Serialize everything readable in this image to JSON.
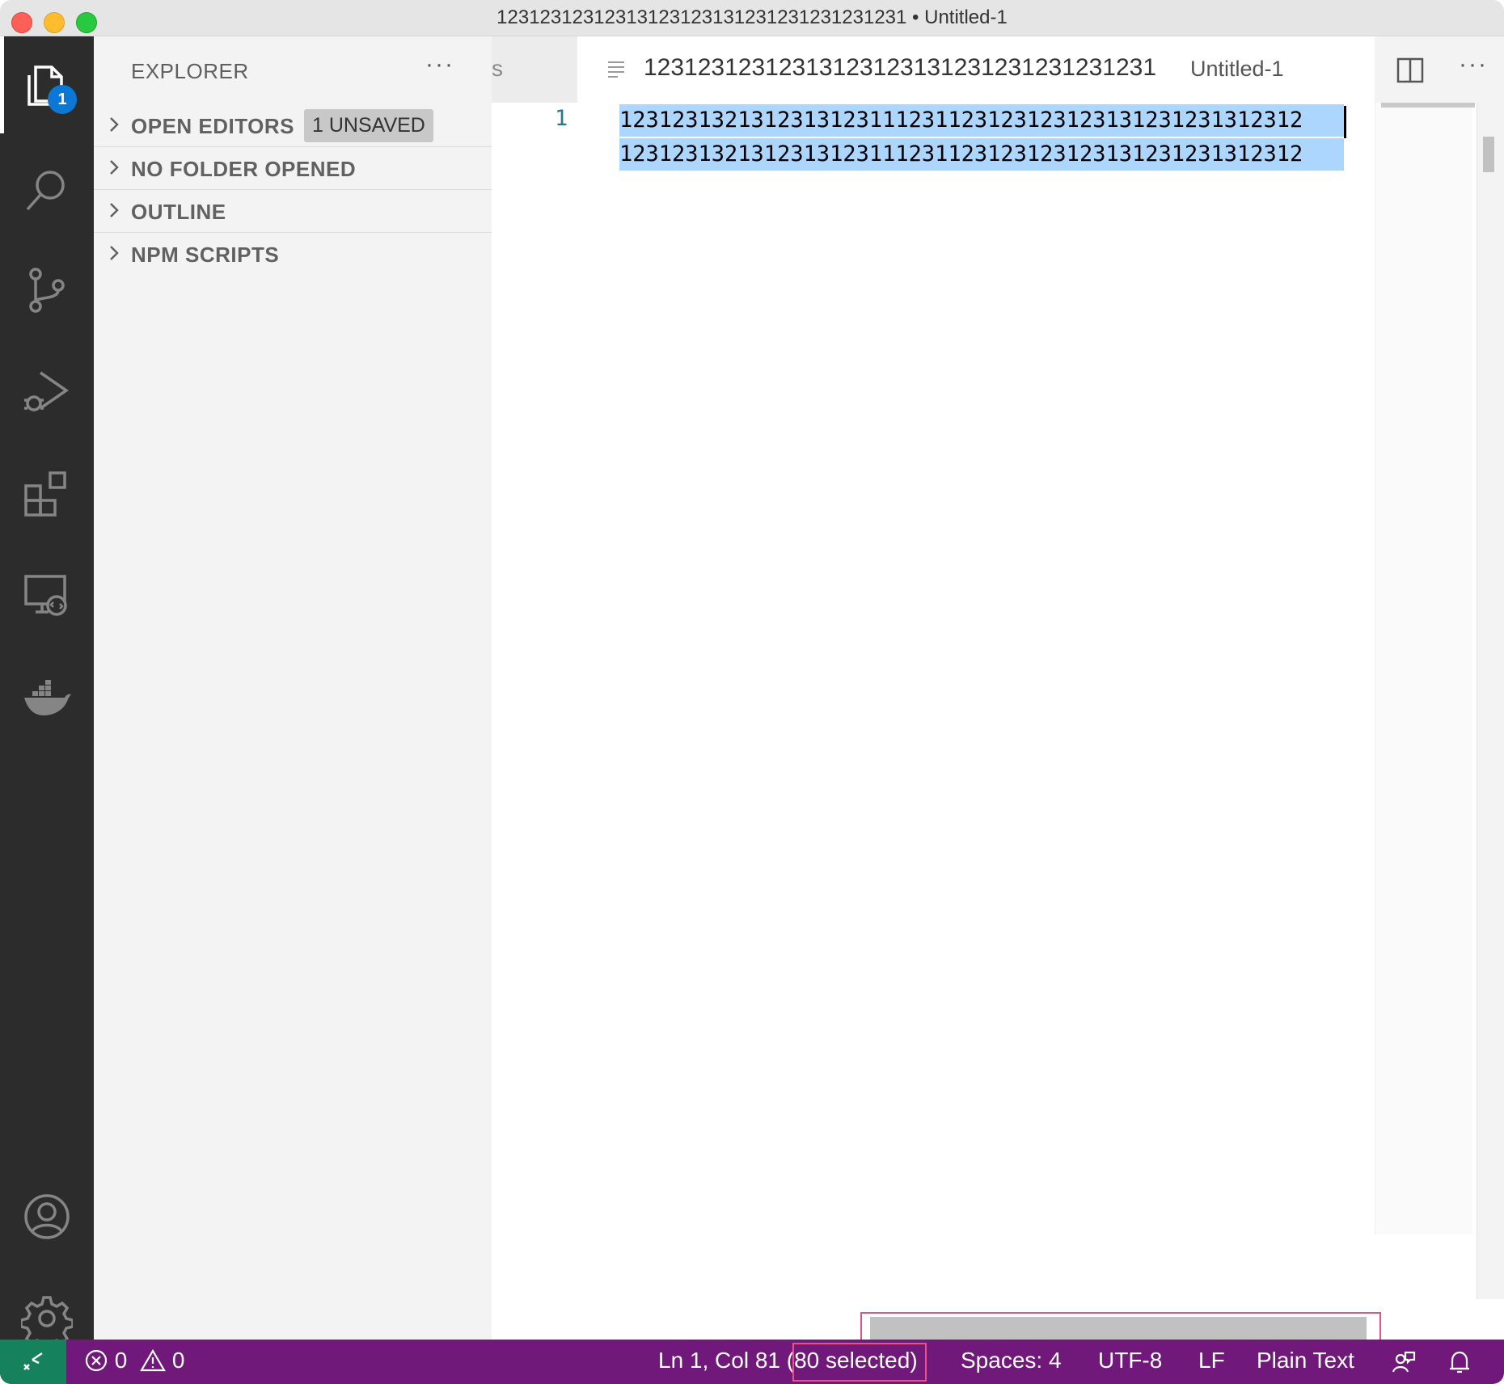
{
  "window": {
    "title": "12312312312313123123131231231231231231 • Untitled-1"
  },
  "activity_bar": {
    "explorer_badge": "1",
    "icons": [
      "files-icon",
      "search-icon",
      "source-control-icon",
      "run-debug-icon",
      "extensions-icon",
      "remote-explorer-icon",
      "docker-icon",
      "account-icon",
      "gear-icon"
    ]
  },
  "sidebar": {
    "title": "EXPLORER",
    "more": "···",
    "sections": [
      {
        "label": "OPEN EDITORS",
        "badge": "1 UNSAVED"
      },
      {
        "label": "NO FOLDER OPENED"
      },
      {
        "label": "OUTLINE"
      },
      {
        "label": "NPM SCRIPTS"
      }
    ]
  },
  "tabs": {
    "inactive_tab_fragment": "s",
    "active_tab": {
      "title": "12312312312313123123131231231231231231",
      "description": "Untitled-1"
    },
    "more": "···"
  },
  "editor": {
    "line_number": "1",
    "lines": [
      "1231231321312313123111231123123123123131231231312312",
      "1231231321312313123111231123123123123131231231312312"
    ]
  },
  "status_bar": {
    "errors": "0",
    "warnings": "0",
    "position": "Ln 1, Col 81",
    "selection": "(80 selected)",
    "spaces": "Spaces: 4",
    "encoding": "UTF-8",
    "eol": "LF",
    "language": "Plain Text"
  },
  "colors": {
    "status_bar_bg": "#70197a",
    "remote_bg": "#16825d",
    "selection_bg": "#add6ff",
    "badge_bg": "#0a78d4",
    "highlight_box": "#e8518a"
  }
}
